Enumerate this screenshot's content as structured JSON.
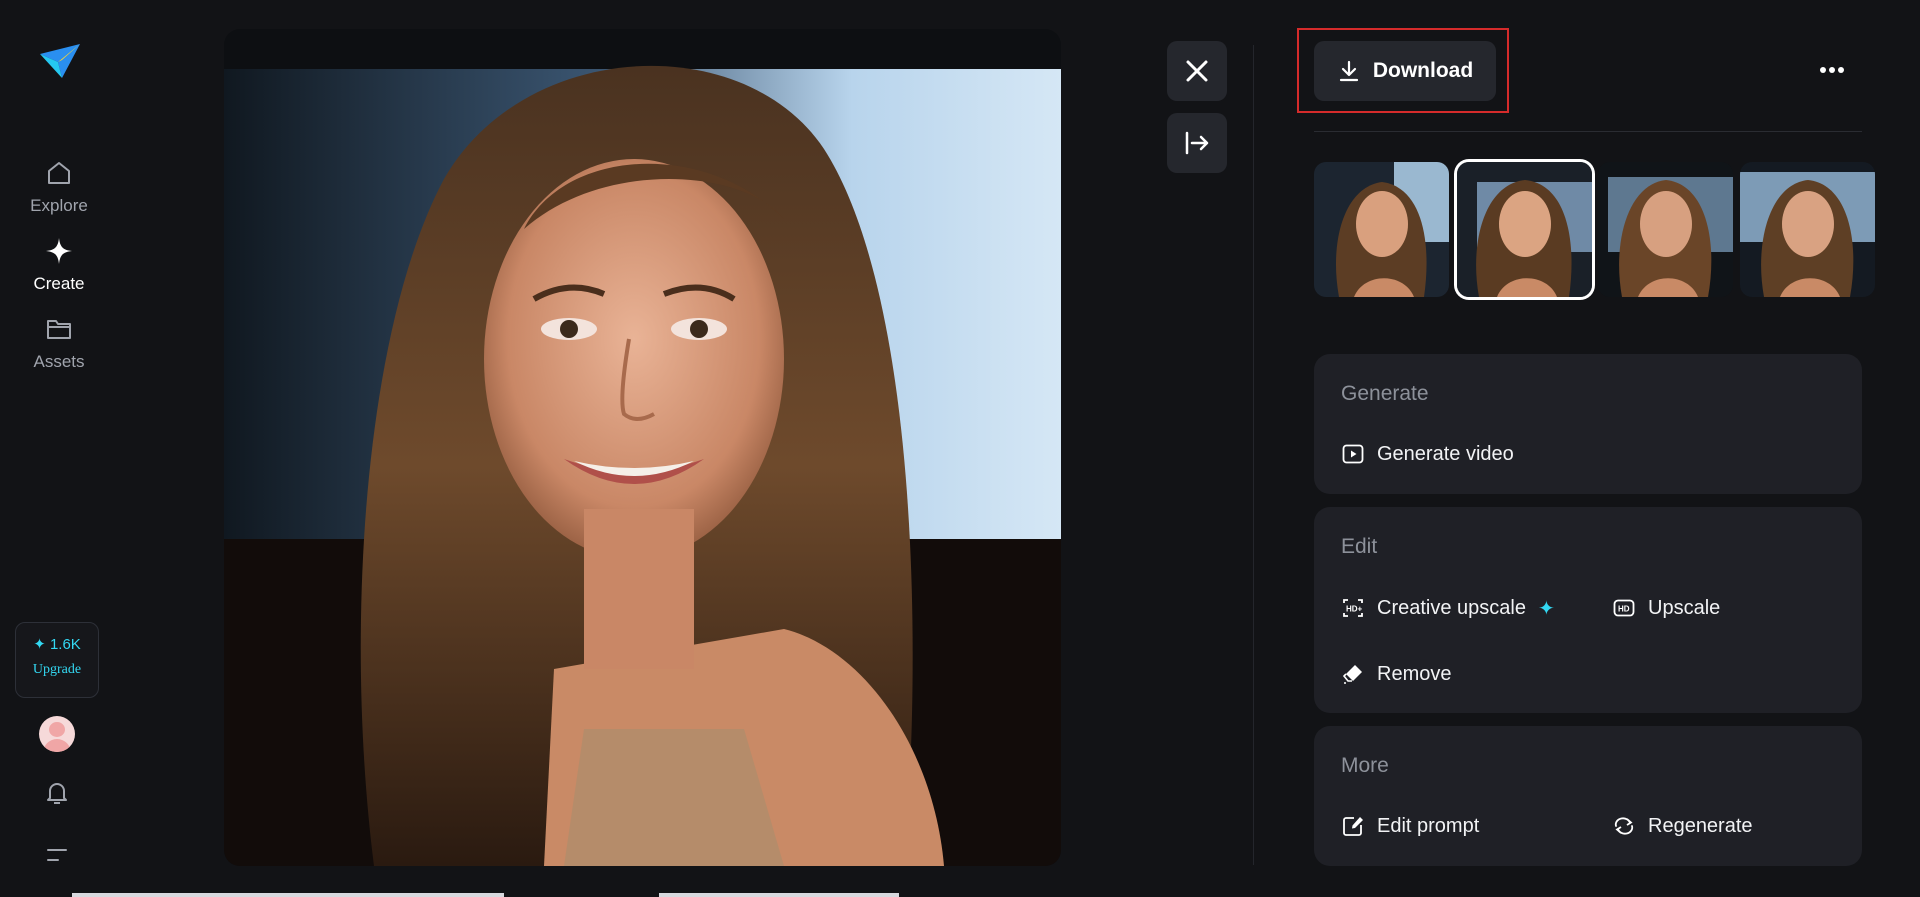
{
  "sidebar": {
    "nav": [
      {
        "label": "Explore",
        "icon": "home-icon"
      },
      {
        "label": "Create",
        "icon": "sparkle-icon"
      },
      {
        "label": "Assets",
        "icon": "folder-icon"
      }
    ],
    "credits": {
      "amount": "1.6K",
      "upgrade_label": "Upgrade"
    }
  },
  "viewer": {
    "close_icon": "close-icon",
    "collapse_icon": "collapse-panel-icon"
  },
  "panel": {
    "download_label": "Download",
    "more_icon": "more-horizontal-icon",
    "thumbnail_count": 4,
    "selected_thumbnail": 2,
    "sections": {
      "generate": {
        "title": "Generate",
        "actions": {
          "generate_video": "Generate video"
        }
      },
      "edit": {
        "title": "Edit",
        "actions": {
          "creative_upscale": "Creative upscale",
          "upscale": "Upscale",
          "remove": "Remove"
        }
      },
      "more": {
        "title": "More",
        "actions": {
          "edit_prompt": "Edit prompt",
          "regenerate": "Regenerate"
        }
      }
    }
  },
  "colors": {
    "accent": "#33d8f2",
    "highlight_border": "#d52b2b",
    "background": "#121316",
    "card": "#1f2026"
  }
}
